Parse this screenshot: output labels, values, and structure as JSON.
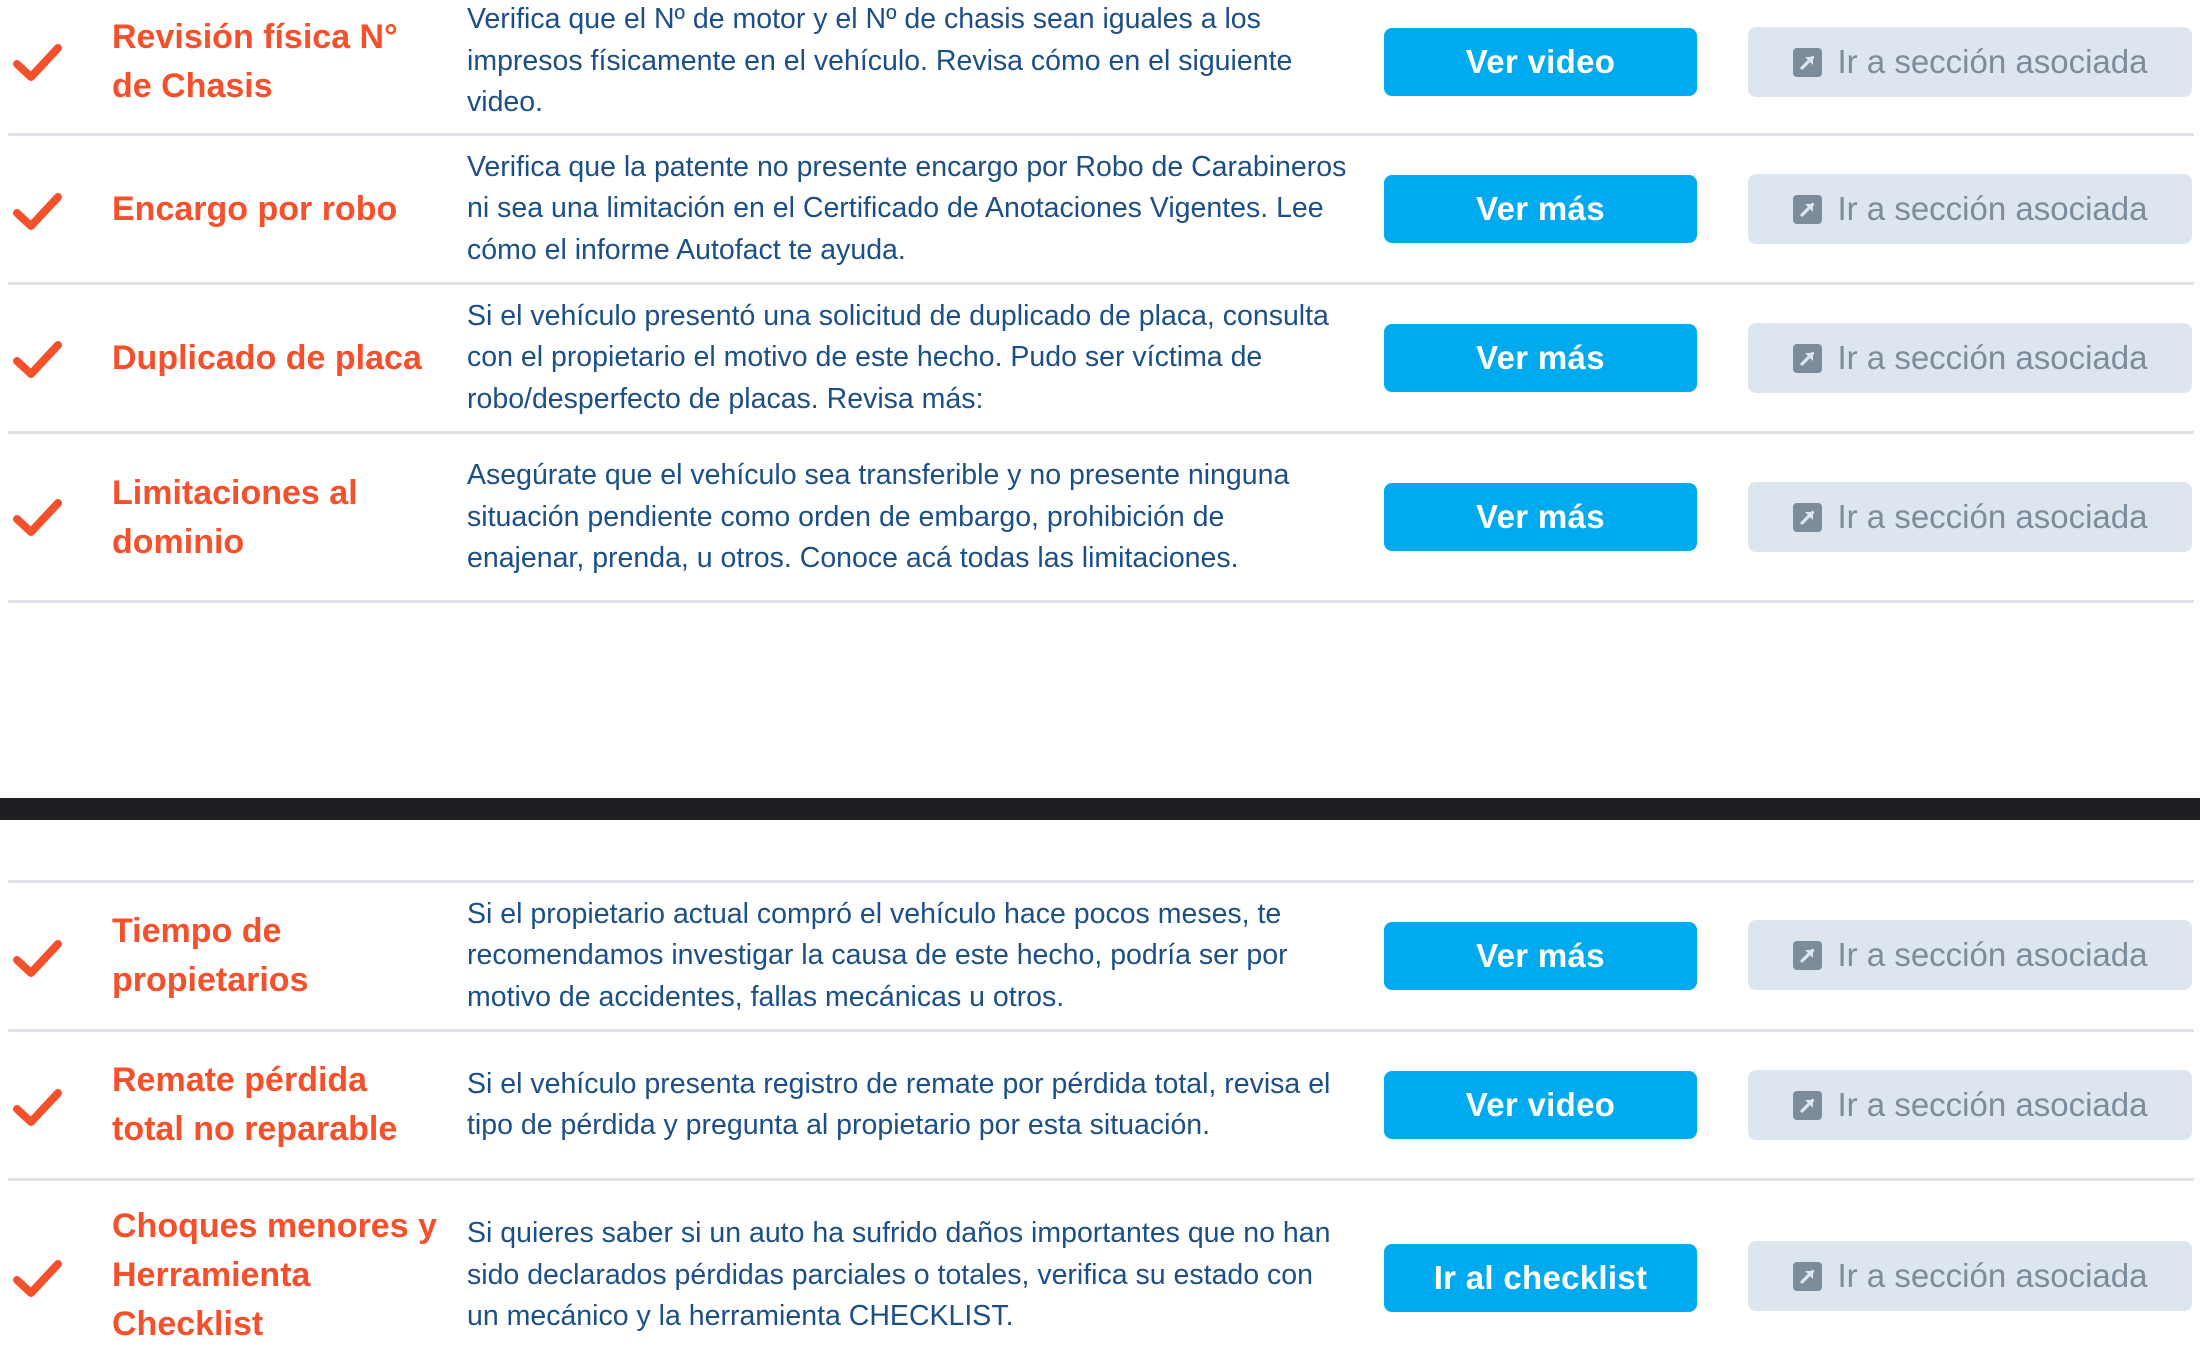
{
  "colors": {
    "accent_orange": "#f4502b",
    "description_blue": "#1c4f86",
    "primary_button": "#00aaee",
    "secondary_button_bg": "#dde6ee",
    "secondary_button_text": "#7c8c9b",
    "divider_bar": "#1e1f22"
  },
  "icons": {
    "status": "check-icon",
    "link": "external-link-icon"
  },
  "sections": [
    {
      "rows": [
        {
          "title": "Revisión física N° de Chasis",
          "description": "Verifica que el Nº de motor y el Nº de chasis sean iguales a los impresos físicamente en el vehículo. Revisa cómo en el siguiente video.",
          "primary_label": "Ver video",
          "secondary_label": "Ir a sección asociada"
        },
        {
          "title": "Encargo por robo",
          "description": "Verifica que la patente no presente encargo por Robo de Carabineros ni sea una limitación en el Certificado de Anotaciones Vigentes. Lee cómo el informe Autofact te ayuda.",
          "primary_label": "Ver más",
          "secondary_label": "Ir a sección asociada"
        },
        {
          "title": "Duplicado de placa",
          "description": "Si el vehículo presentó una solicitud de duplicado de placa, consulta con el propietario el motivo de este hecho. Pudo ser víctima de robo/desperfecto de placas. Revisa más:",
          "primary_label": "Ver más",
          "secondary_label": "Ir a sección asociada"
        },
        {
          "title": "Limitaciones al dominio",
          "description": "Asegúrate que el vehículo sea transferible y no presente ninguna situación pendiente como orden de embargo, prohibición de enajenar, prenda, u otros. Conoce acá todas las limitaciones.",
          "primary_label": "Ver más",
          "secondary_label": "Ir a sección asociada"
        }
      ]
    },
    {
      "rows": [
        {
          "title": "Tiempo de propietarios",
          "description": "Si el propietario actual compró el vehículo hace pocos meses, te recomendamos investigar la causa de este hecho, podría ser por motivo de accidentes, fallas mecánicas u otros.",
          "primary_label": "Ver más",
          "secondary_label": "Ir a sección asociada"
        },
        {
          "title": "Remate pérdida total no reparable",
          "description": "Si el vehículo presenta registro de remate por pérdida total, revisa el tipo de pérdida y pregunta al propietario por esta situación.",
          "primary_label": "Ver video",
          "secondary_label": "Ir a sección asociada"
        },
        {
          "title": "Choques menores y Herramienta Checklist",
          "description": "Si quieres saber si un auto ha sufrido daños importantes que no han sido declarados pérdidas parciales o totales, verifica su estado con un mecánico y la herramienta CHECKLIST.",
          "primary_label": "Ir al checklist",
          "secondary_label": "Ir a sección asociada"
        }
      ]
    }
  ]
}
